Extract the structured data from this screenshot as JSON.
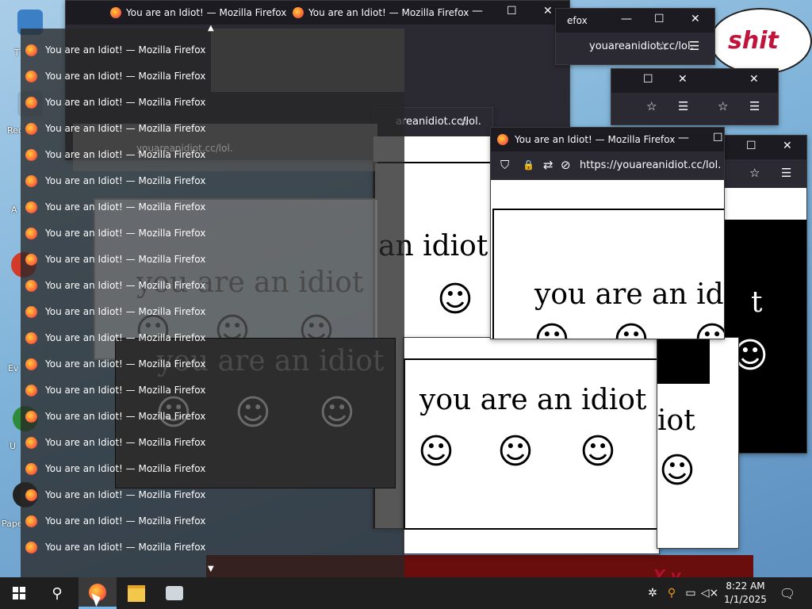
{
  "window_title": "You are an Idiot! — Mozilla Firefox",
  "url": "https://youareanidiot.cc/lol.",
  "url_trunc_a": "youareanidiot.cc/lol.",
  "url_trunc_b": "areanidiot.cc/lol.",
  "url_trunc_c": "t.cc/lol.",
  "page_text": "you are an idiot",
  "page_text_partial_a": "an idiot",
  "page_text_partial_b": "you are an idio",
  "page_text_partial_c": "iot",
  "page_text_partial_d": "t",
  "smiley": "☺",
  "speech_text": "shit",
  "icons": {
    "minimize": "—",
    "maximize": "☐",
    "close": "✕",
    "shield": "⛉",
    "lock": "🔒",
    "star": "☆",
    "menu": "☰",
    "permissions": "⇄"
  },
  "jumplist": {
    "items": [
      "You are an Idiot! — Mozilla Firefox",
      "You are an Idiot! — Mozilla Firefox",
      "You are an Idiot! — Mozilla Firefox",
      "You are an Idiot! — Mozilla Firefox",
      "You are an Idiot! — Mozilla Firefox",
      "You are an Idiot! — Mozilla Firefox",
      "You are an Idiot! — Mozilla Firefox",
      "You are an Idiot! — Mozilla Firefox",
      "You are an Idiot! — Mozilla Firefox",
      "You are an Idiot! — Mozilla Firefox",
      "You are an Idiot! — Mozilla Firefox",
      "You are an Idiot! — Mozilla Firefox",
      "You are an Idiot! — Mozilla Firefox",
      "You are an Idiot! — Mozilla Firefox",
      "You are an Idiot! — Mozilla Firefox",
      "You are an Idiot! — Mozilla Firefox",
      "You are an Idiot! — Mozilla Firefox",
      "You are an Idiot! — Mozilla Firefox",
      "You are an Idiot! — Mozilla Firefox",
      "You are an Idiot! — Mozilla Firefox"
    ]
  },
  "desktop_labels": [
    "T",
    "Rec",
    "A",
    "Ev",
    "U",
    "Pape"
  ],
  "taskbar": {
    "time": "8:22 AM",
    "date": "1/1/2025"
  },
  "colors": {
    "firefox_titlebar": "#1c1b22",
    "firefox_toolbar": "#2b2a33",
    "taskbar": "#1f1f1f",
    "speech_red": "#c0143c",
    "running_indicator": "#76b9ed"
  }
}
